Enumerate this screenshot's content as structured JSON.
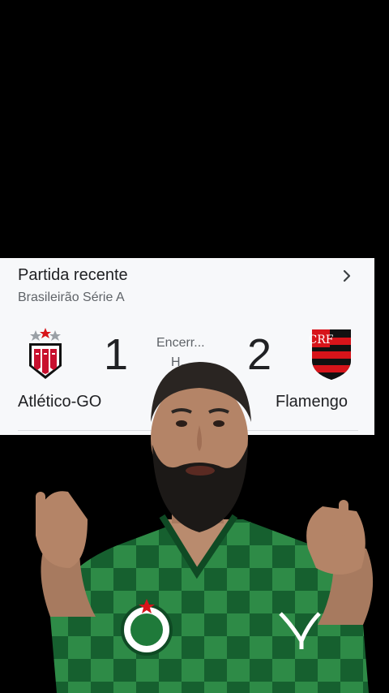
{
  "card": {
    "title": "Partida recente",
    "subtitle": "Brasileirão Série A",
    "status": "Encerr...",
    "status_sub": "H...",
    "home": {
      "name": "Atlético-GO",
      "score": "1"
    },
    "away": {
      "name": "Flamengo",
      "score": "2"
    }
  },
  "icons": {
    "chevron": "chevron-right-icon",
    "home_crest": "atletico-go-crest-icon",
    "away_crest": "flamengo-crest-icon",
    "club_badge": "palmeiras-badge-icon"
  },
  "colors": {
    "card_bg": "#f7f8fa",
    "flamengo_red": "#d7141a",
    "atletico_red": "#c8102e",
    "jersey_green": "#1f7a3a"
  }
}
